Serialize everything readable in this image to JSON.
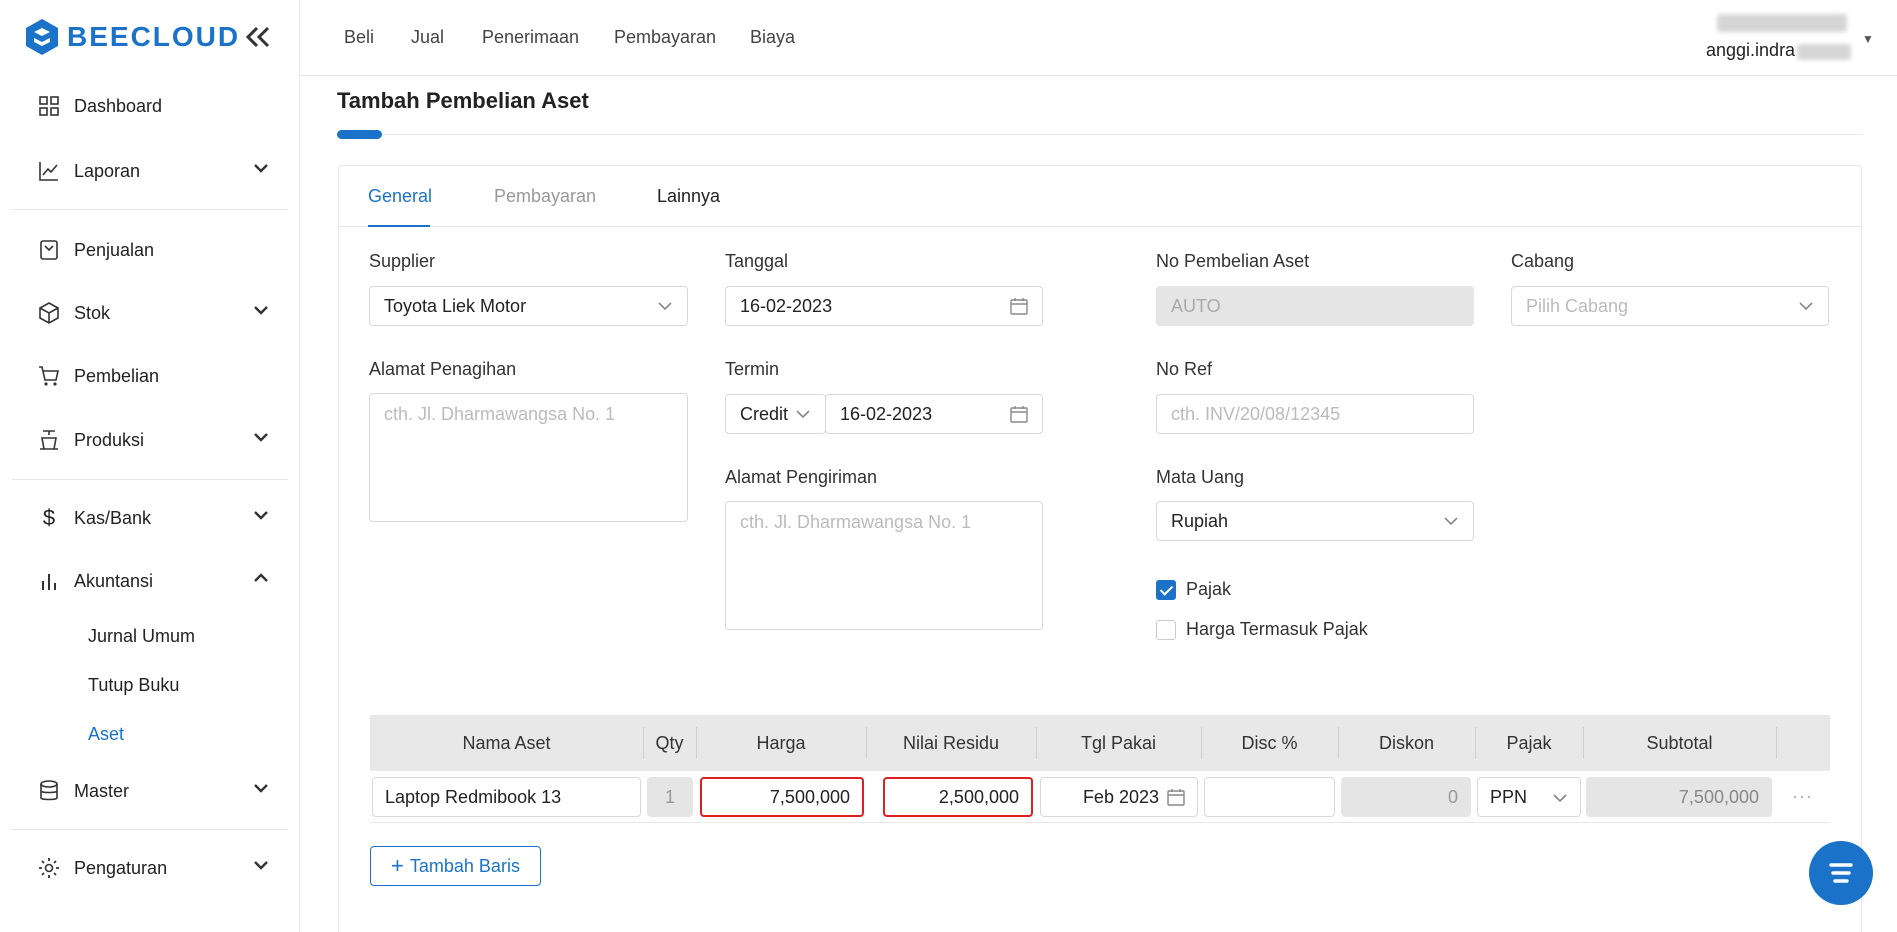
{
  "app": {
    "logo_text": "BEECLOUD"
  },
  "sidebar": {
    "items": [
      {
        "label": "Dashboard",
        "icon": "dashboard-icon"
      },
      {
        "label": "Laporan",
        "icon": "chart-line-icon"
      },
      {
        "label": "Penjualan",
        "icon": "sale-icon"
      },
      {
        "label": "Stok",
        "icon": "box-icon"
      },
      {
        "label": "Pembelian",
        "icon": "cart-icon"
      },
      {
        "label": "Produksi",
        "icon": "production-icon"
      },
      {
        "label": "Kas/Bank",
        "icon": "dollar-icon"
      },
      {
        "label": "Akuntansi",
        "icon": "bar-chart-icon"
      },
      {
        "label": "Master",
        "icon": "database-icon"
      },
      {
        "label": "Pengaturan",
        "icon": "gear-icon"
      }
    ],
    "sub_items": [
      "Jurnal Umum",
      "Tutup Buku",
      "Aset"
    ],
    "active_sub": "Aset"
  },
  "topnav": [
    "Beli",
    "Jual",
    "Penerimaan",
    "Pembayaran",
    "Biaya"
  ],
  "user": {
    "email_visible": "anggi.indra"
  },
  "page": {
    "title": "Tambah Pembelian Aset"
  },
  "tabs": [
    "General",
    "Pembayaran",
    "Lainnya"
  ],
  "form": {
    "supplier_label": "Supplier",
    "supplier_value": "Toyota Liek Motor",
    "tanggal_label": "Tanggal",
    "tanggal_value": "16-02-2023",
    "no_pembelian_label": "No Pembelian Aset",
    "no_pembelian_value": "AUTO",
    "cabang_label": "Cabang",
    "cabang_placeholder": "Pilih Cabang",
    "alamat_penagihan_label": "Alamat Penagihan",
    "alamat_penagihan_placeholder": "cth. Jl. Dharmawangsa No. 1",
    "termin_label": "Termin",
    "termin_type": "Credit",
    "termin_date": "16-02-2023",
    "no_ref_label": "No Ref",
    "no_ref_placeholder": "cth. INV/20/08/12345",
    "alamat_pengiriman_label": "Alamat Pengiriman",
    "alamat_pengiriman_placeholder": "cth. Jl. Dharmawangsa No. 1",
    "mata_uang_label": "Mata Uang",
    "mata_uang_value": "Rupiah",
    "pajak_label": "Pajak",
    "pajak_checked": true,
    "harga_termasuk_pajak_label": "Harga Termasuk Pajak",
    "harga_termasuk_pajak_checked": false
  },
  "table": {
    "headers": [
      "Nama Aset",
      "Qty",
      "Harga",
      "Nilai Residu",
      "Tgl Pakai",
      "Disc %",
      "Diskon",
      "Pajak",
      "Subtotal"
    ],
    "row": {
      "nama": "Laptop Redmibook 13",
      "qty": "1",
      "harga": "7,500,000",
      "nilai_residu": "2,500,000",
      "tgl_pakai": "Feb 2023",
      "disc_pct": "",
      "diskon": "0",
      "pajak": "PPN",
      "subtotal": "7,500,000"
    },
    "more": "···"
  },
  "buttons": {
    "add_row": "Tambah Baris"
  },
  "colors": {
    "accent": "#1a73c9",
    "highlight": "#e02020"
  }
}
